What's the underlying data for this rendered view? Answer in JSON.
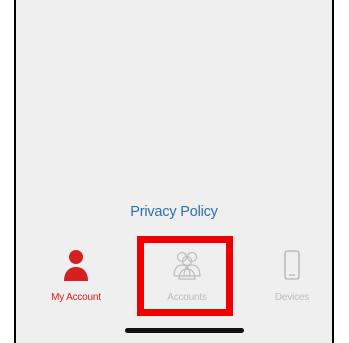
{
  "footer": {
    "privacy_link": "Privacy Policy"
  },
  "tabbar": {
    "tabs": [
      {
        "label": "My Account",
        "icon": "person-icon",
        "state": "active",
        "color": "#d42020"
      },
      {
        "label": "Accounts",
        "icon": "people-icon",
        "state": "inactive",
        "color": "#bdbdbd"
      },
      {
        "label": "Devices",
        "icon": "phone-icon",
        "state": "inactive",
        "color": "#bdbdbd"
      }
    ]
  },
  "colors": {
    "accent_red": "#d42020",
    "link_blue": "#2f6fb3",
    "background": "#efefef",
    "annotation_red": "#f00000"
  }
}
